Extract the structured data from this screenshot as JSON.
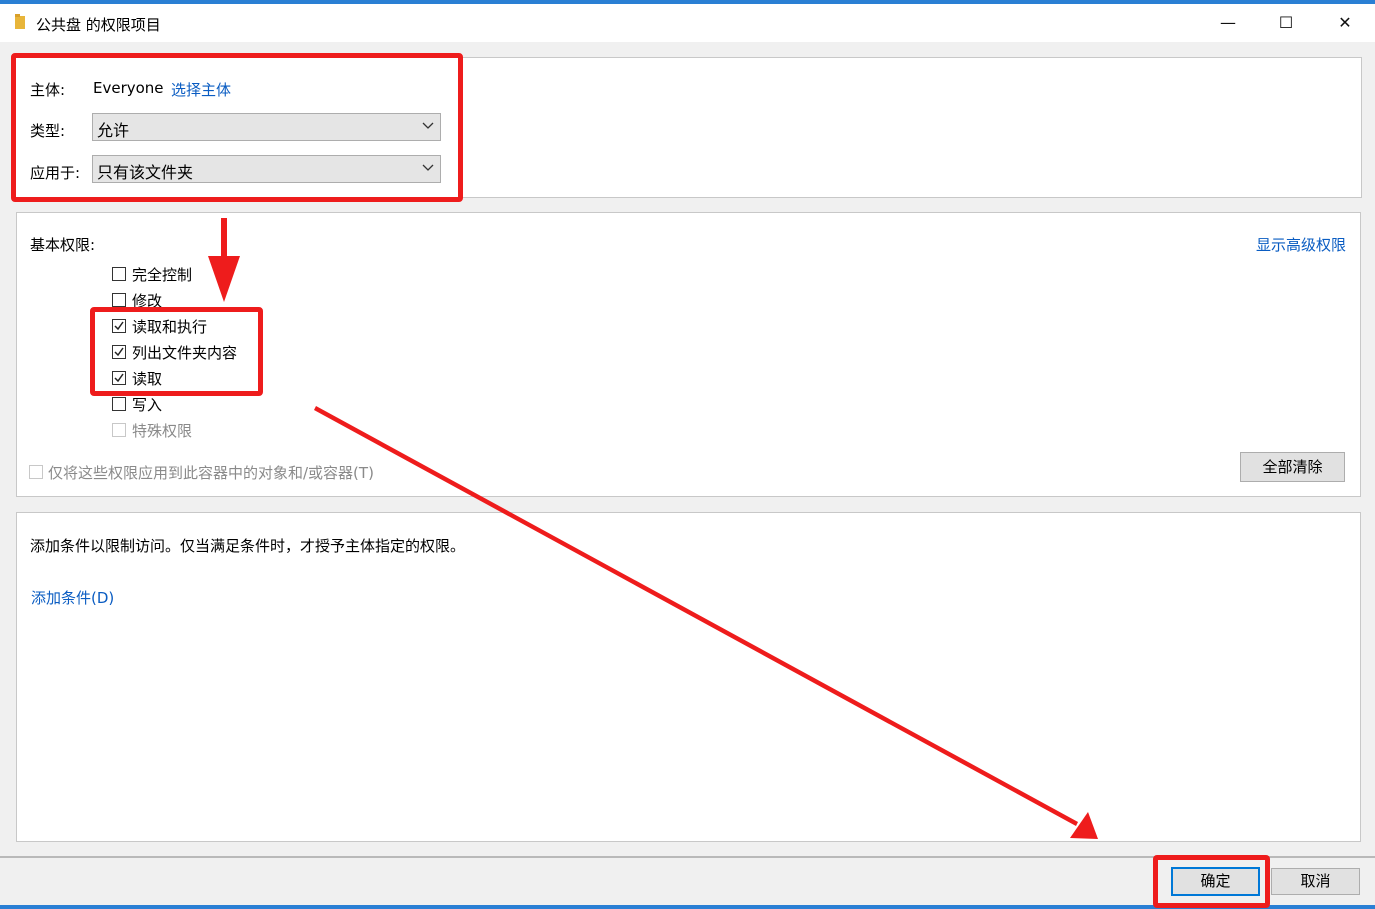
{
  "window": {
    "title": "公共盘 的权限项目",
    "controls": {
      "minimize": "—",
      "maximize": "☐",
      "close": "✕"
    }
  },
  "principal": {
    "label": "主体:",
    "value": "Everyone",
    "select_link": "选择主体",
    "type_label": "类型:",
    "type_value": "允许",
    "applies_label": "应用于:",
    "applies_value": "只有该文件夹"
  },
  "permissions": {
    "heading": "基本权限:",
    "show_advanced": "显示高级权限",
    "items": [
      {
        "label": "完全控制",
        "checked": false,
        "enabled": true
      },
      {
        "label": "修改",
        "checked": false,
        "enabled": true
      },
      {
        "label": "读取和执行",
        "checked": true,
        "enabled": true
      },
      {
        "label": "列出文件夹内容",
        "checked": true,
        "enabled": true
      },
      {
        "label": "读取",
        "checked": true,
        "enabled": true
      },
      {
        "label": "写入",
        "checked": false,
        "enabled": true
      },
      {
        "label": "特殊权限",
        "checked": false,
        "enabled": false
      }
    ],
    "apply_only_label": "仅将这些权限应用到此容器中的对象和/或容器(T)",
    "clear_all": "全部清除"
  },
  "conditions": {
    "description": "添加条件以限制访问。仅当满足条件时，才授予主体指定的权限。",
    "add_link": "添加条件(D)"
  },
  "footer": {
    "ok": "确定",
    "cancel": "取消"
  },
  "colors": {
    "annotation": "#ee1c1c",
    "link": "#0a5cc2",
    "accent": "#0078d7"
  }
}
